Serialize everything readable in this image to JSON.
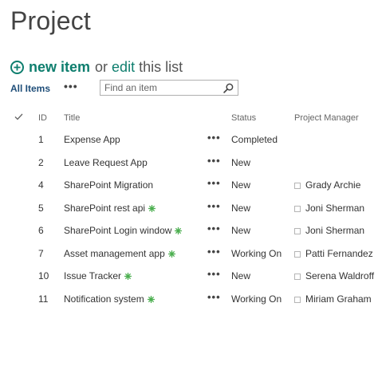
{
  "page": {
    "title": "Project"
  },
  "command_bar": {
    "new_item_label": "new item",
    "or_label": "or",
    "edit_label": "edit",
    "this_list_label": "this list"
  },
  "view": {
    "current_view": "All Items",
    "ellipsis": "•••",
    "search_placeholder": "Find an item",
    "search_value": ""
  },
  "columns": {
    "id": "ID",
    "title": "Title",
    "status": "Status",
    "project_manager": "Project Manager"
  },
  "row_menu_label": "•••",
  "rows": [
    {
      "id": "1",
      "title": "Expense App",
      "status": "Completed",
      "project_manager": ""
    },
    {
      "id": "2",
      "title": "Leave Request App",
      "status": "New",
      "project_manager": ""
    },
    {
      "id": "4",
      "title": "SharePoint Migration",
      "status": "New",
      "project_manager": "Grady Archie"
    },
    {
      "id": "5",
      "title": "SharePoint rest api",
      "status": "New",
      "project_manager": "Joni Sherman",
      "is_new": true
    },
    {
      "id": "6",
      "title": "SharePoint Login window",
      "status": "New",
      "project_manager": "Joni Sherman",
      "is_new": true
    },
    {
      "id": "7",
      "title": "Asset management app",
      "status": "Working On",
      "project_manager": "Patti Fernandez",
      "is_new": true
    },
    {
      "id": "10",
      "title": "Issue Tracker",
      "status": "New",
      "project_manager": "Serena Waldroff",
      "is_new": true
    },
    {
      "id": "11",
      "title": "Notification system",
      "status": "Working On",
      "project_manager": "Miriam Graham",
      "is_new": true
    }
  ],
  "colors": {
    "accent": "#0e7e6e",
    "new_badge": "#4caf50",
    "view_label": "#1f4e79"
  },
  "icons": {
    "add": "plus-circle-icon",
    "search": "search-icon",
    "select_all": "checkmark-icon",
    "new_item_badge": "new-item-badge-icon",
    "presence": "presence-icon"
  }
}
